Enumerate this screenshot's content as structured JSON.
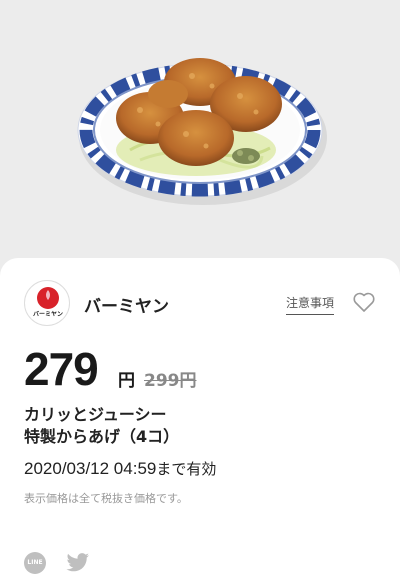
{
  "brand": {
    "name": "バーミヤン",
    "logo_text": "バーミヤン"
  },
  "actions": {
    "notes_label": "注意事項",
    "favorite_icon": "heart-outline-icon"
  },
  "offer": {
    "price": "279",
    "price_unit": "円",
    "original_price": "299円",
    "title_line1": "カリッとジューシー",
    "title_line2": "特製からあげ（4コ）",
    "expiry_date": "2020/03/12 04:59",
    "expiry_suffix": "まで有効",
    "tax_note": "表示価格は全て税抜き価格です。"
  },
  "share": {
    "line_label": "LINE",
    "twitter_icon": "twitter-bird-icon"
  },
  "colors": {
    "background": "#ececec",
    "card": "#ffffff",
    "accent_red": "#d8222a",
    "plate_blue": "#2f4f9e"
  }
}
